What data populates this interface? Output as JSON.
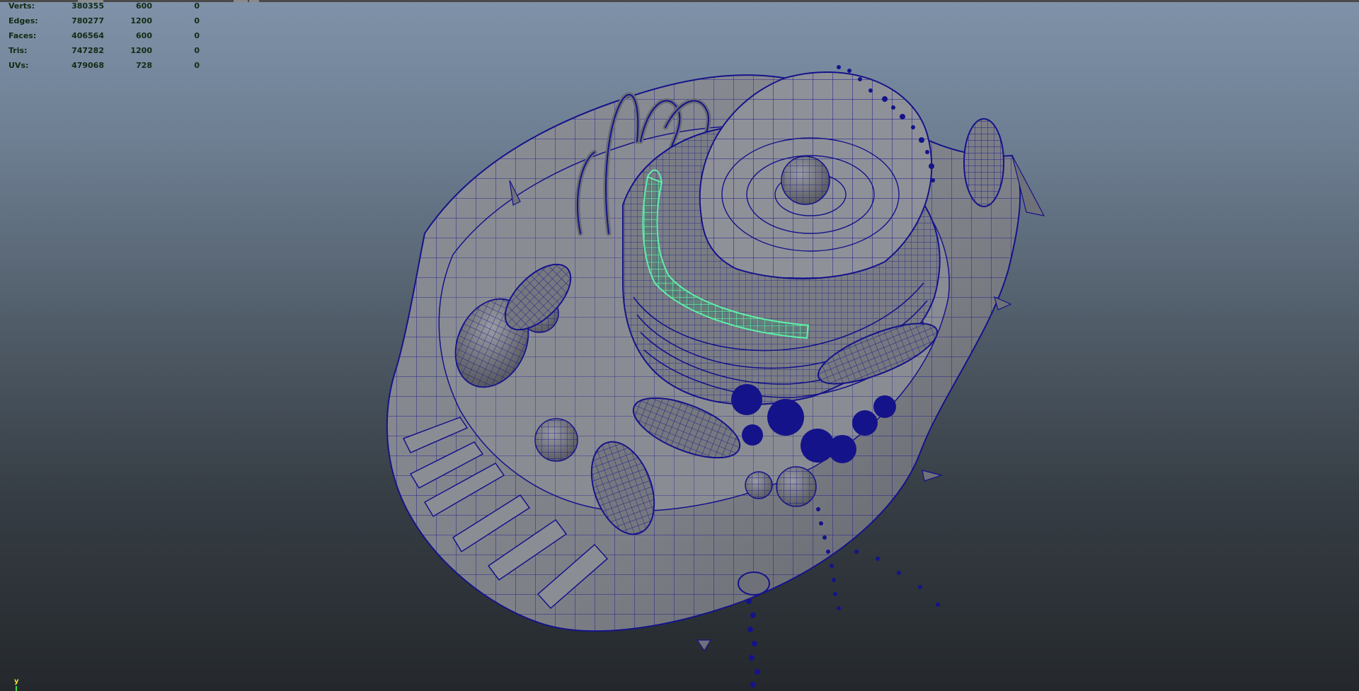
{
  "heads_up_display": {
    "rows": [
      {
        "label": "Verts:",
        "values": [
          "380355",
          "600",
          "0"
        ]
      },
      {
        "label": "Edges:",
        "values": [
          "780277",
          "1200",
          "0"
        ]
      },
      {
        "label": "Faces:",
        "values": [
          "406564",
          "600",
          "0"
        ]
      },
      {
        "label": "Tris:",
        "values": [
          "747282",
          "1200",
          "0"
        ]
      },
      {
        "label": "UVs:",
        "values": [
          "479068",
          "728",
          "0"
        ]
      }
    ]
  },
  "view_axis": {
    "label": "y"
  },
  "colors": {
    "wireframe": "#14138a",
    "selection_highlight": "#5ef0a8",
    "surface_shade": "#8e8f96",
    "hud_text": "#142a14"
  },
  "scene": {
    "subject": "animal cell polygon model",
    "selected_object": "endoplasmic reticulum layer (highlighted green)"
  }
}
